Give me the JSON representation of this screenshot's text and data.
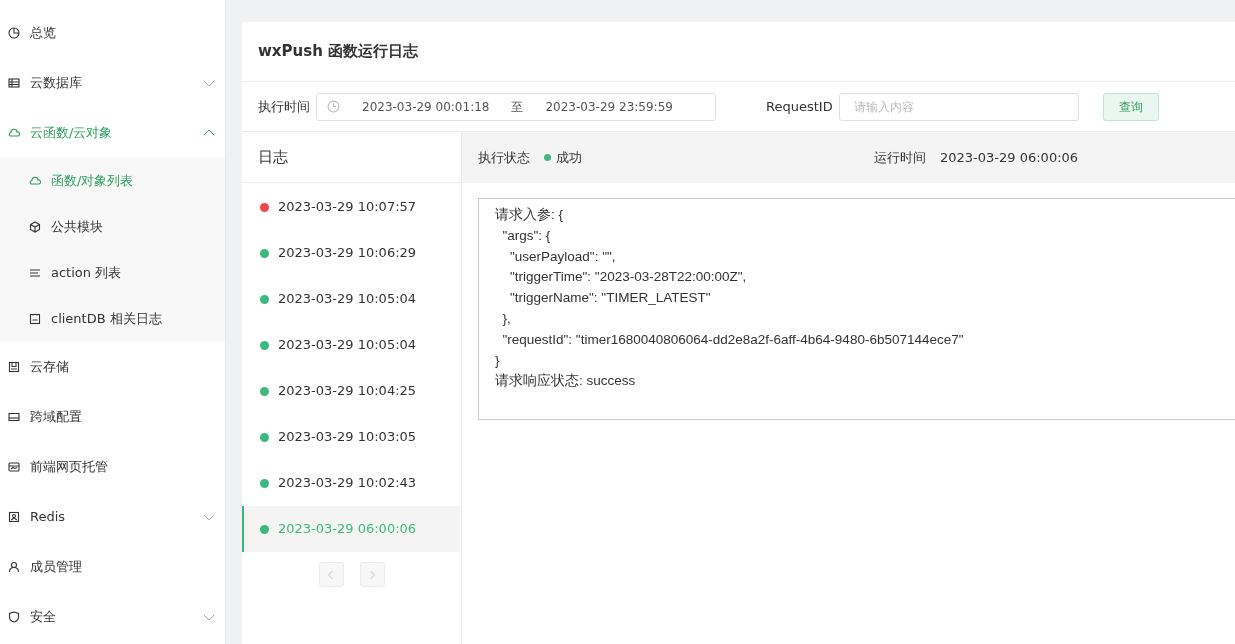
{
  "sidebar": {
    "items": [
      {
        "label": "总览",
        "selected": false
      },
      {
        "label": "云数据库",
        "selected": false,
        "expanded": false
      },
      {
        "label": "云函数/云对象",
        "selected": true,
        "expanded": true,
        "children": [
          {
            "label": "函数/对象列表",
            "selected": true
          },
          {
            "label": "公共模块",
            "selected": false
          },
          {
            "label": "action 列表",
            "selected": false
          },
          {
            "label": "clientDB 相关日志",
            "selected": false
          }
        ]
      },
      {
        "label": "云存储",
        "selected": false
      },
      {
        "label": "跨域配置",
        "selected": false
      },
      {
        "label": "前端网页托管",
        "selected": false
      },
      {
        "label": "Redis",
        "selected": false,
        "expanded": false
      },
      {
        "label": "成员管理",
        "selected": false
      },
      {
        "label": "安全",
        "selected": false,
        "expanded": false
      }
    ]
  },
  "panel": {
    "title": "wxPush 函数运行日志",
    "filters": {
      "time_label": "执行时间",
      "start": "2023-03-29 00:01:18",
      "separator": "至",
      "end": "2023-03-29 23:59:59",
      "request_label": "RequestID",
      "request_placeholder": "请输入内容",
      "search_button": "查询"
    },
    "log_list": {
      "heading": "日志",
      "items": [
        {
          "time": "2023-03-29 10:07:57",
          "color": "#f0474f",
          "selected": false
        },
        {
          "time": "2023-03-29 10:06:29",
          "color": "#3cba7e",
          "selected": false
        },
        {
          "time": "2023-03-29 10:05:04",
          "color": "#3cba7e",
          "selected": false
        },
        {
          "time": "2023-03-29 10:05:04",
          "color": "#3cba7e",
          "selected": false
        },
        {
          "time": "2023-03-29 10:04:25",
          "color": "#3cba7e",
          "selected": false
        },
        {
          "time": "2023-03-29 10:03:05",
          "color": "#3cba7e",
          "selected": false
        },
        {
          "time": "2023-03-29 10:02:43",
          "color": "#3cba7e",
          "selected": false
        },
        {
          "time": "2023-03-29 06:00:06",
          "color": "#3cba7e",
          "selected": true
        }
      ],
      "pager": {
        "prev_disabled": true,
        "next_disabled": true
      }
    },
    "detail": {
      "status_label": "执行状态",
      "status": "成功",
      "runtime_label": "运行时间",
      "runtime": "2023-03-29 06:00:06",
      "log_text": "请求入参: {\n  \"args\": {\n    \"userPayload\": \"\",\n    \"triggerTime\": \"2023-03-28T22:00:00Z\",\n    \"triggerName\": \"TIMER_LATEST\"\n  },\n  \"requestId\": \"timer1680040806064-dd2e8a2f-6aff-4b64-9480-6b507144ece7\"\n}\n请求响应状态: success"
    }
  }
}
